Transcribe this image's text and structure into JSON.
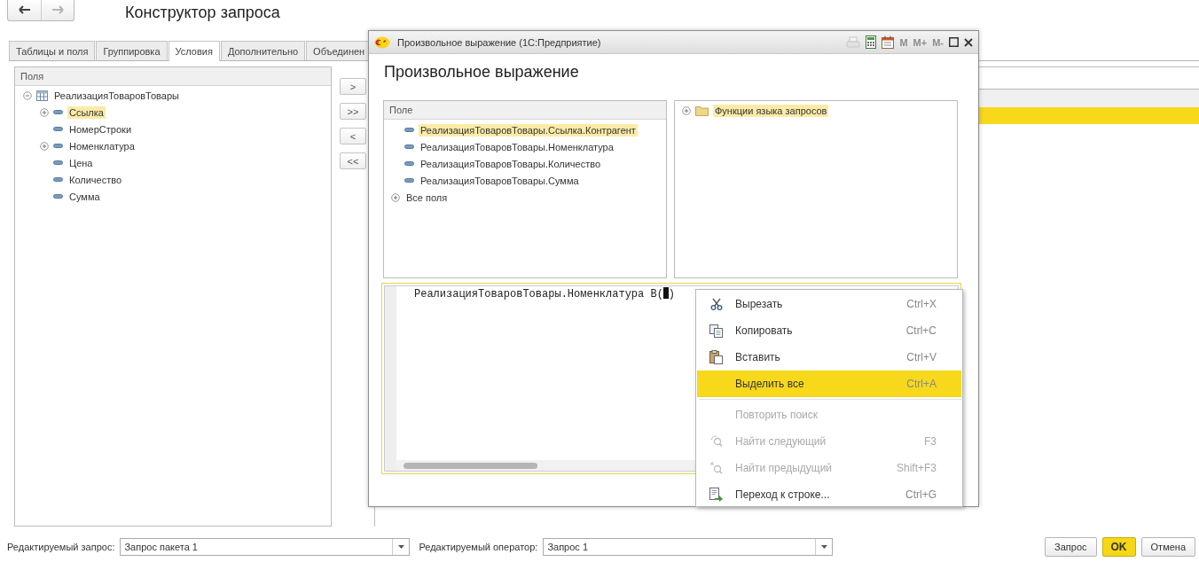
{
  "navigation": [
    {
      "disabled": false
    },
    {
      "disabled": true
    }
  ],
  "title": "Конструктор запроса",
  "tabs": [
    {
      "label": "Таблицы и поля",
      "selected": false
    },
    {
      "label": "Группировка",
      "selected": false
    },
    {
      "label": "Условия",
      "selected": true
    },
    {
      "label": "Дополнительно",
      "selected": false
    },
    {
      "label": "Объединен",
      "selected": false
    }
  ],
  "fields_panel": {
    "header": "Поля",
    "tree": [
      {
        "label": "РеализацияТоваровТовары",
        "kind": "table",
        "expanded": true,
        "selected": false,
        "children": [
          {
            "label": "Ссылка",
            "kind": "field",
            "expanded": false,
            "selected": true
          },
          {
            "label": "НомерСтроки",
            "kind": "field",
            "selected": false
          },
          {
            "label": "Номенклатура",
            "kind": "field",
            "expanded": false,
            "selected": false
          },
          {
            "label": "Цена",
            "kind": "field",
            "selected": false
          },
          {
            "label": "Количество",
            "kind": "field",
            "selected": false
          },
          {
            "label": "Сумма",
            "kind": "field",
            "selected": false
          }
        ]
      }
    ]
  },
  "move_buttons": [
    ">",
    ">>",
    "<",
    "<<"
  ],
  "conditions_table": {
    "rows": [
      {
        "selected": true
      }
    ]
  },
  "dialog": {
    "title": "Произвольное выражение  (1С:Предприятие)",
    "memory_buttons": [
      {
        "label": "M",
        "disabled": true
      },
      {
        "label": "M+",
        "disabled": true
      },
      {
        "label": "M-",
        "disabled": true
      }
    ],
    "heading": "Произвольное выражение",
    "fields": {
      "header": "Поле",
      "items": [
        {
          "label": "РеализацияТоваровТовары.Ссылка.Контрагент",
          "kind": "field",
          "selected": true
        },
        {
          "label": "РеализацияТоваровТовары.Номенклатура",
          "kind": "field",
          "selected": false
        },
        {
          "label": "РеализацияТоваровТовары.Количество",
          "kind": "field",
          "selected": false
        },
        {
          "label": "РеализацияТоваровТовары.Сумма",
          "kind": "field",
          "selected": false
        },
        {
          "label": "Все поля",
          "kind": "group",
          "expanded": false,
          "selected": false
        }
      ]
    },
    "functions": [
      {
        "label": "Функции языка запросов",
        "kind": "folder",
        "expanded": false,
        "selected": true
      }
    ],
    "expression": {
      "text": "РеализацияТоваровТовары.Номенклатура В(",
      "text_after_cursor": ")"
    }
  },
  "context_menu": [
    {
      "kind": "item",
      "label": "Вырезать",
      "shortcut": "Ctrl+X",
      "disabled": false,
      "selected": false
    },
    {
      "kind": "item",
      "label": "Копировать",
      "shortcut": "Ctrl+C",
      "disabled": false,
      "selected": false
    },
    {
      "kind": "item",
      "label": "Вставить",
      "shortcut": "Ctrl+V",
      "disabled": false,
      "selected": false
    },
    {
      "kind": "item",
      "label": "Выделить все",
      "shortcut": "Ctrl+A",
      "disabled": false,
      "selected": true
    },
    {
      "kind": "separator"
    },
    {
      "kind": "item",
      "label": "Повторить поиск",
      "disabled": true,
      "selected": false
    },
    {
      "kind": "item",
      "label": "Найти следующий",
      "shortcut": "F3",
      "disabled": true,
      "selected": false
    },
    {
      "kind": "item",
      "label": "Найти предыдущий",
      "shortcut": "Shift+F3",
      "disabled": true,
      "selected": false
    },
    {
      "kind": "item",
      "label": "Переход к строке...",
      "shortcut": "Ctrl+G",
      "disabled": false,
      "selected": false
    }
  ],
  "footer": {
    "query_label": "Редактируемый запрос:",
    "query_value": "Запрос пакета 1",
    "operator_label": "Редактируемый оператор:",
    "operator_value": "Запрос 1",
    "buttons": [
      {
        "label": "Запрос",
        "kind": "normal"
      },
      {
        "label": "OK",
        "kind": "default"
      },
      {
        "label": "Отмена",
        "kind": "normal"
      }
    ]
  }
}
